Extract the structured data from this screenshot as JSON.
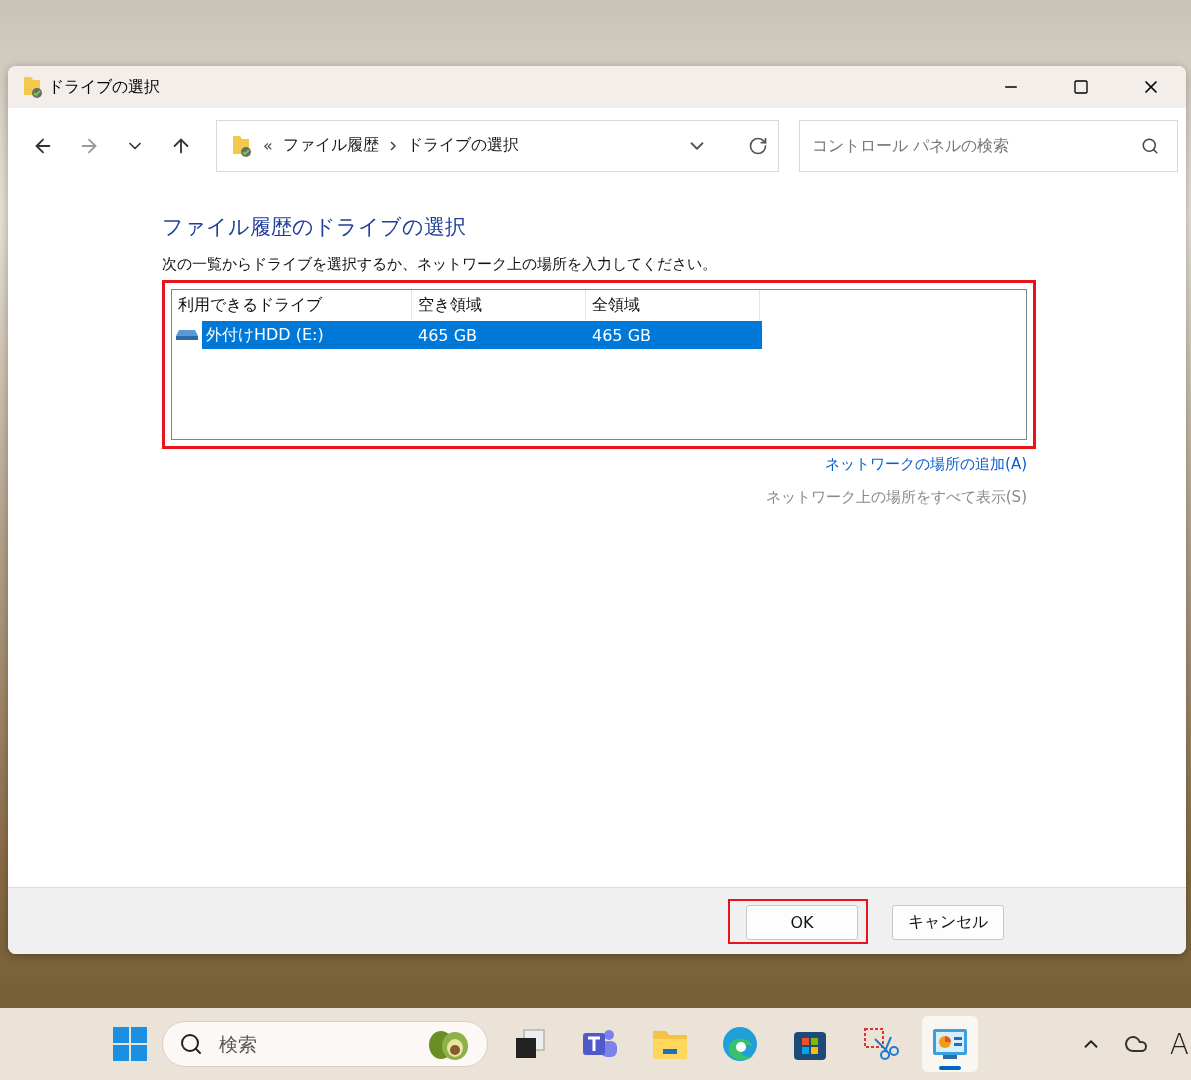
{
  "window": {
    "title": "ドライブの選択"
  },
  "nav": [
    {
      "kind": "back",
      "disabled": false
    },
    {
      "kind": "forward",
      "disabled": true
    },
    {
      "kind": "recent",
      "disabled": false
    },
    {
      "kind": "up",
      "disabled": false
    }
  ],
  "address": {
    "overflow": "«",
    "breadcrumbs": [
      "ファイル履歴",
      "ドライブの選択"
    ]
  },
  "search": {
    "placeholder": "コントロール パネルの検索"
  },
  "heading": "ファイル履歴のドライブの選択",
  "description": "次の一覧からドライブを選択するか、ネットワーク上の場所を入力してください。",
  "drives": {
    "highlighted": true,
    "columns": [
      "利用できるドライブ",
      "空き領域",
      "全領域"
    ],
    "rows": [
      {
        "cells": [
          "外付けHDD (E:)",
          "465 GB",
          "465 GB"
        ],
        "selected": true
      }
    ]
  },
  "links": [
    {
      "label": "ネットワークの場所の追加(A)",
      "disabled": false
    },
    {
      "label": "ネットワーク上の場所をすべて表示(S)",
      "disabled": true
    }
  ],
  "buttons": [
    {
      "label": "OK",
      "highlighted": true
    },
    {
      "label": "キャンセル",
      "highlighted": false
    }
  ],
  "taskbar": {
    "search_placeholder": "検索",
    "apps": [
      {
        "kind": "taskview",
        "active": false
      },
      {
        "kind": "teams",
        "active": false
      },
      {
        "kind": "explorer",
        "active": false
      },
      {
        "kind": "edge",
        "active": false
      },
      {
        "kind": "store",
        "active": false
      },
      {
        "kind": "snip",
        "active": false
      },
      {
        "kind": "control",
        "active": true
      }
    ],
    "ime": "A"
  }
}
